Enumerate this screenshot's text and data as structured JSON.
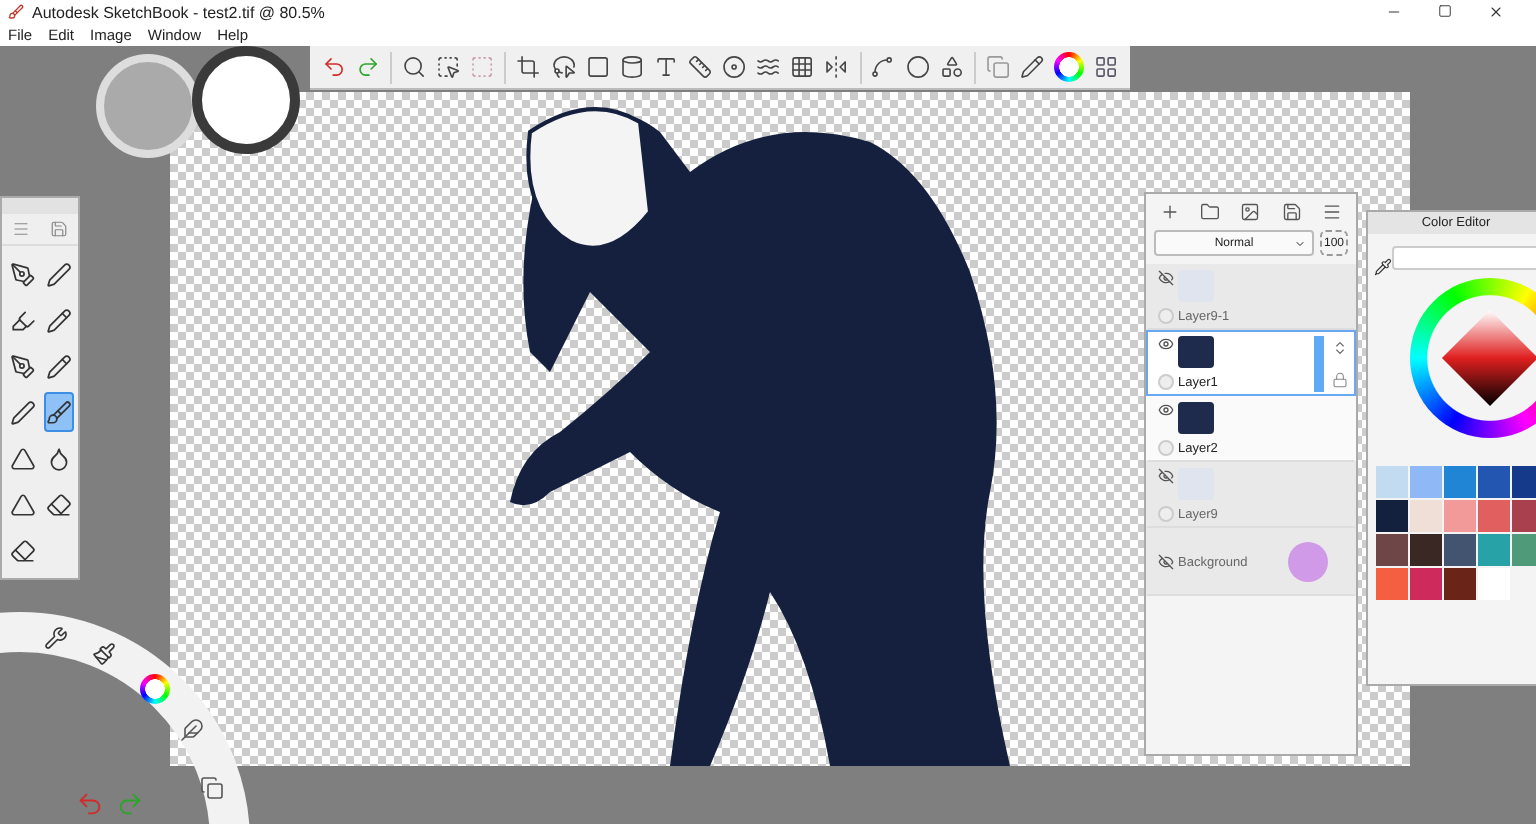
{
  "window": {
    "title": "Autodesk SketchBook - test2.tif @ 80.5%"
  },
  "menu": [
    "File",
    "Edit",
    "Image",
    "Window",
    "Help"
  ],
  "brushes": [
    {
      "selected": false
    },
    {
      "selected": false
    },
    {
      "selected": false
    },
    {
      "selected": false
    },
    {
      "selected": false
    },
    {
      "selected": false
    },
    {
      "selected": false
    },
    {
      "selected": true
    },
    {
      "selected": false
    },
    {
      "selected": false
    },
    {
      "selected": false
    },
    {
      "selected": false
    },
    {
      "selected": false
    }
  ],
  "layers_panel": {
    "blend_mode": "Normal",
    "opacity": "100",
    "layers": [
      {
        "name": "Layer9-1",
        "kind": "layer",
        "visible": false,
        "selected": false
      },
      {
        "name": "Layer1",
        "kind": "layer",
        "visible": true,
        "selected": true
      },
      {
        "name": "Layer2",
        "kind": "layer",
        "visible": true,
        "selected": false
      },
      {
        "name": "Layer9",
        "kind": "layer",
        "visible": false,
        "selected": false
      },
      {
        "name": "Background",
        "kind": "background",
        "visible": false,
        "selected": false,
        "color": "#d09ae8"
      }
    ]
  },
  "color_editor": {
    "title": "Color Editor",
    "swatches": [
      {
        "color": "#c3dbf0"
      },
      {
        "color": "#8fb8f6"
      },
      {
        "color": "#2185d6"
      },
      {
        "color": "#2356b0"
      },
      {
        "color": "#163a8a"
      },
      {
        "color": "#13213f"
      },
      {
        "color": "#efdfd6"
      },
      {
        "color": "#f29a9a"
      },
      {
        "color": "#e0605f"
      },
      {
        "color": "#a8404e"
      },
      {
        "color": "#6f4648"
      },
      {
        "color": "#3a2824"
      },
      {
        "color": "#425470"
      },
      {
        "color": "#27a2a6"
      },
      {
        "color": "#4f9a78"
      },
      {
        "color": "#f35f40"
      },
      {
        "color": "#cf2a5c"
      },
      {
        "color": "#6b2518"
      },
      {
        "color": "#ffffff"
      }
    ]
  }
}
